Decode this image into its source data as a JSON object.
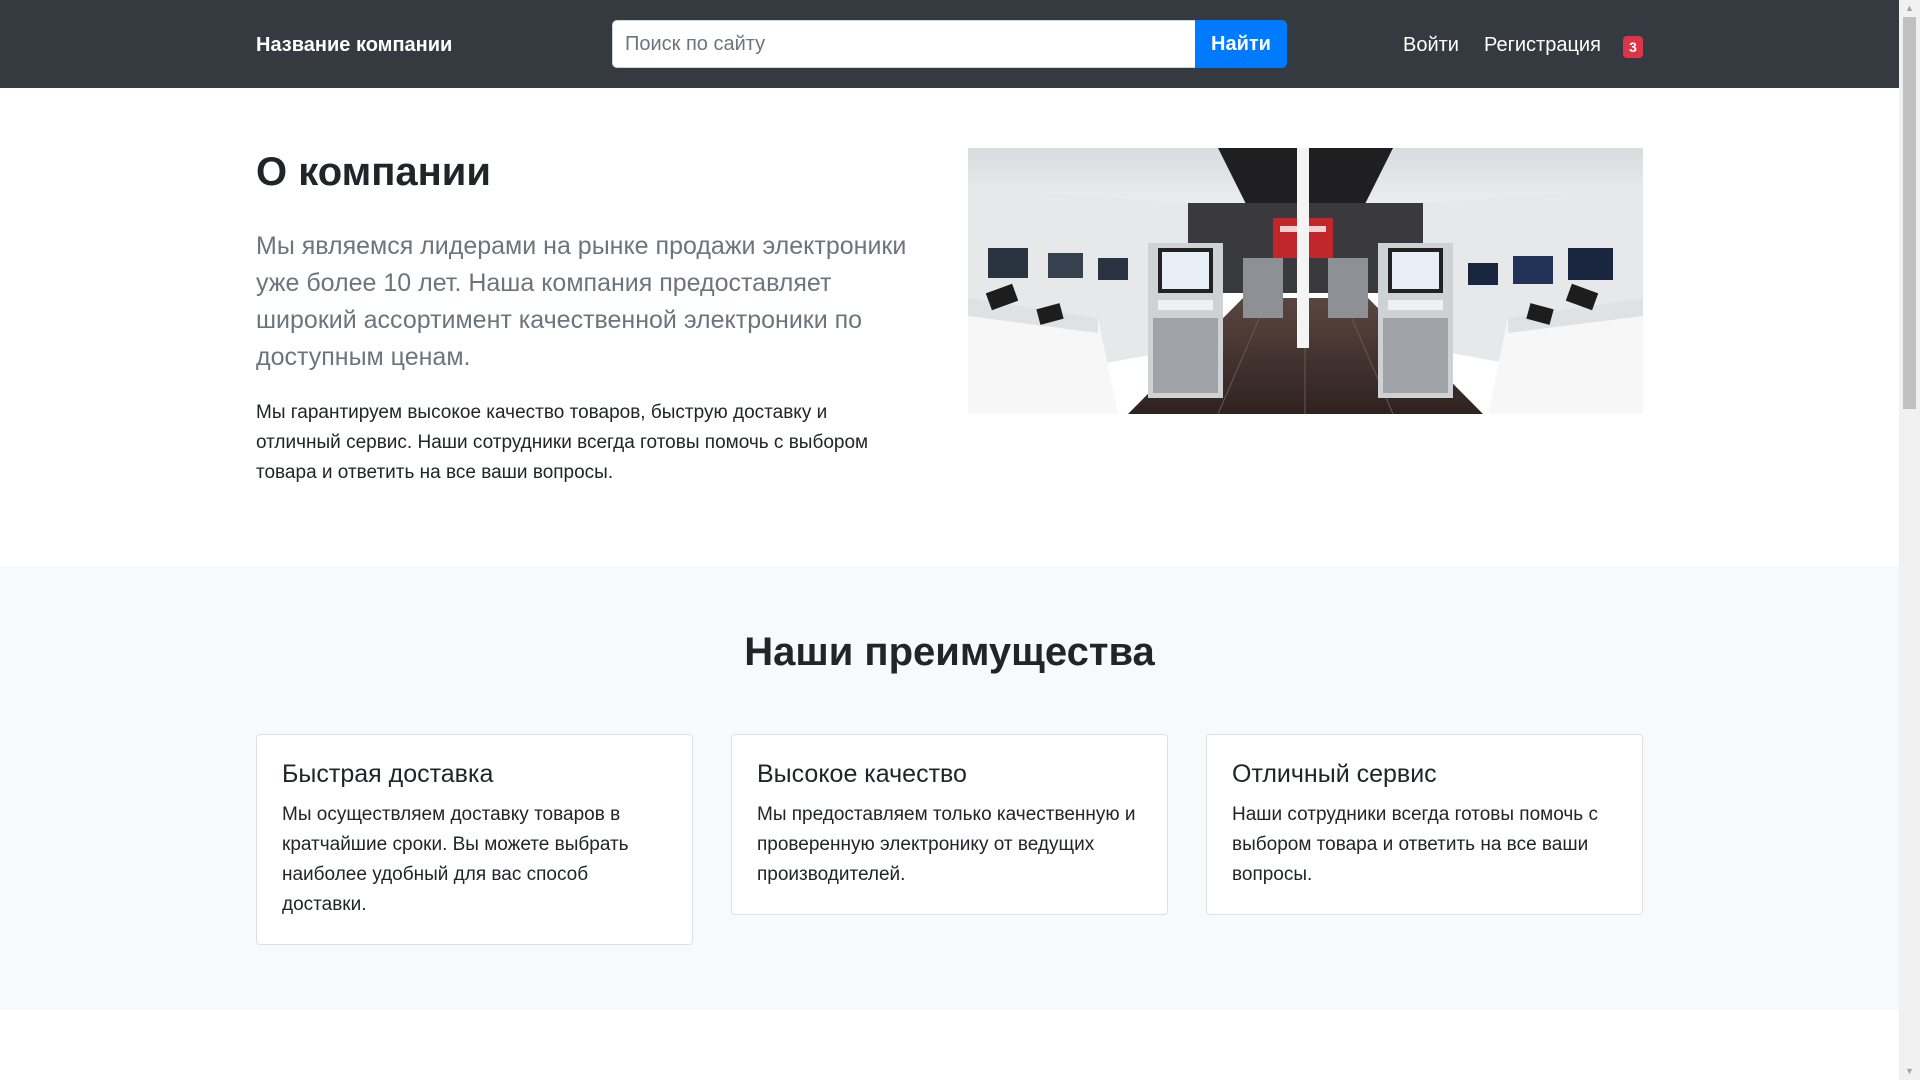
{
  "navbar": {
    "brand": "Название компании",
    "search": {
      "placeholder": "Поиск по сайту",
      "value": "",
      "button_label": "Найти"
    },
    "links": {
      "login": "Войти",
      "register": "Регистрация"
    },
    "badge_count": "3"
  },
  "about": {
    "title": "О компании",
    "lead": "Мы являемся лидерами на рынке продажи электроники уже более 10 лет. Наша компания предоставляет широкий ассортимент качественной электроники по доступным ценам.",
    "text": "Мы гарантируем высокое качество товаров, быструю доставку и отличный сервис. Наши сотрудники всегда готовы помочь с выбором товара и ответить на все ваши вопросы."
  },
  "advantages": {
    "title": "Наши преимущества",
    "cards": [
      {
        "title": "Быстрая доставка",
        "text": "Мы осуществляем доставку товаров в кратчайшие сроки. Вы можете выбрать наиболее удобный для вас способ доставки."
      },
      {
        "title": "Высокое качество",
        "text": "Мы предоставляем только качественную и проверенную электронику от ведущих производителей."
      },
      {
        "title": "Отличный сервис",
        "text": "Наши сотрудники всегда готовы помочь с выбором товара и ответить на все ваши вопросы."
      }
    ]
  },
  "colors": {
    "navbar_bg": "#343a40",
    "primary": "#007bff",
    "badge": "#dc3545",
    "section_bg": "#f8f9fa",
    "lead_text": "#6c757d"
  },
  "icons": {
    "scroll_up": "scroll-up-arrow-icon",
    "scroll_down": "scroll-down-arrow-icon"
  }
}
